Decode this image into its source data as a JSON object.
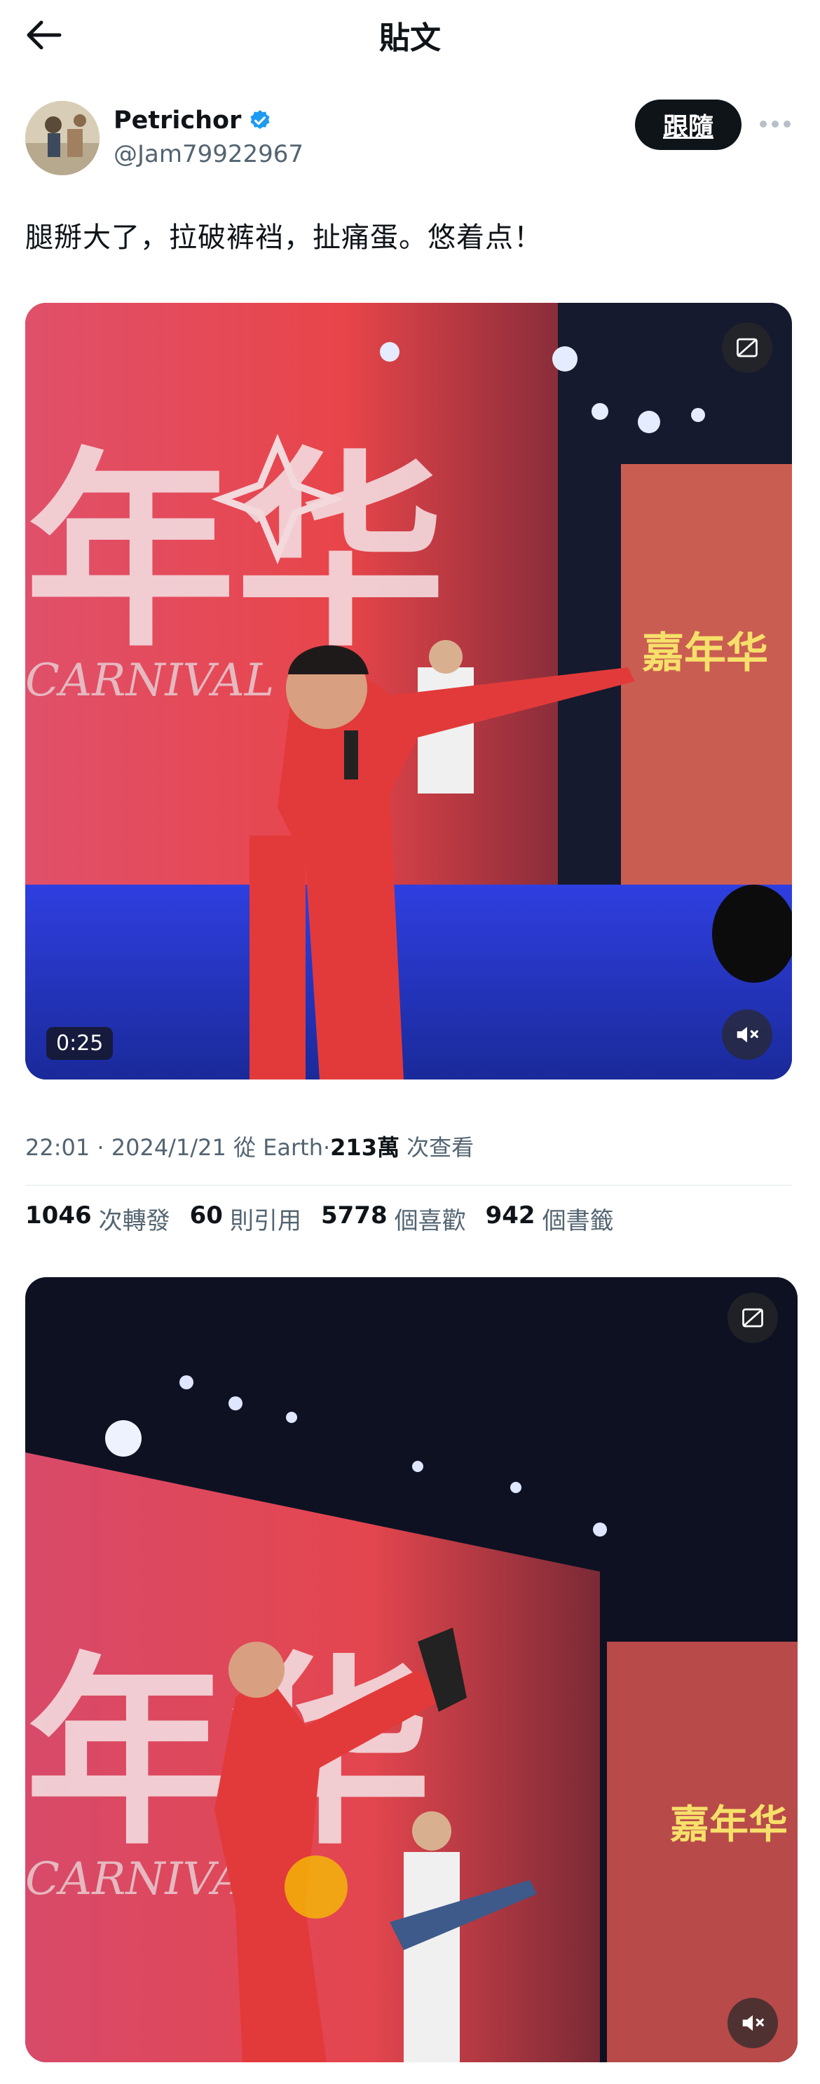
{
  "header": {
    "title": "貼文"
  },
  "author": {
    "name": "Petrichor",
    "handle": "@Jam79922967",
    "follow_label": "跟隨"
  },
  "tweet": {
    "text": "腿掰大了，拉破裤裆，扯痛蛋。悠着点！"
  },
  "media": [
    {
      "duration": "0:25",
      "stage_text": "年华",
      "stage_sub": "CARNIVAL",
      "screen_text": "嘉年华"
    },
    {
      "stage_text": "年华",
      "stage_sub": "CARNIVAL",
      "screen_text": "嘉年华"
    }
  ],
  "meta": {
    "time": "22:01",
    "date": "2024/1/21",
    "source_prefix": "從",
    "source": "Earth",
    "views_num": "213萬",
    "views_label": "次查看",
    "sep": "·"
  },
  "stats": [
    {
      "num": "1046",
      "label": "次轉發"
    },
    {
      "num": "60",
      "label": "則引用"
    },
    {
      "num": "5778",
      "label": "個喜歡"
    },
    {
      "num": "942",
      "label": "個書籤"
    }
  ],
  "colors": {
    "text": "#0f1419",
    "secondary": "#536471",
    "verified": "#1d9bf0",
    "stage_red": "#e23a3a",
    "stage_blue": "#2236d8"
  },
  "icons": [
    "back-arrow-icon",
    "verified-badge-icon",
    "more-dots-icon",
    "sensitive-media-icon",
    "mute-icon"
  ]
}
